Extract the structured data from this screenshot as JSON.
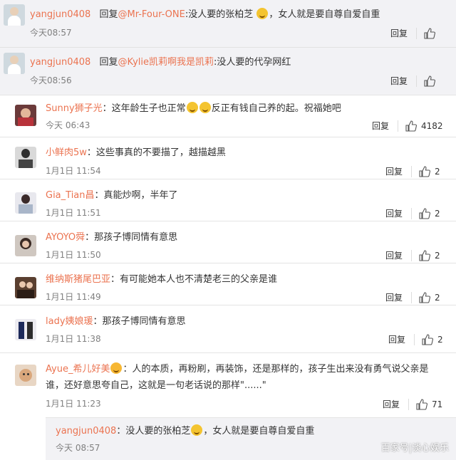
{
  "comments": [
    {
      "username": "yangjun0408",
      "reply_prefix": "回复",
      "reply_target": "@Mr-Four-ONE",
      "text_before": ":没人要的张柏芝",
      "text_after": "，女人就是要自尊自爱自重",
      "time": "今天08:57",
      "reply_label": "回复",
      "likes": ""
    },
    {
      "username": "yangjun0408",
      "reply_prefix": "回复",
      "reply_target": "@Kylie凯莉啊我是凯莉",
      "text_before": ":没人要的代孕网红",
      "time": "今天08:56",
      "reply_label": "回复",
      "likes": ""
    },
    {
      "username": "Sunny狮子光",
      "text_before": "：这年龄生子也正常",
      "text_after": "反正有钱自己养的起。祝福她吧",
      "time": "今天 06:43",
      "reply_label": "回复",
      "likes": "4182"
    },
    {
      "username": "小鲜肉5w",
      "text_before": "：这些事真的不要描了，越描越黑",
      "time": "1月1日 11:54",
      "reply_label": "回复",
      "likes": "2"
    },
    {
      "username": "Gia_Tian昌",
      "text_before": "：真能炒啊，半年了",
      "time": "1月1日 11:51",
      "reply_label": "回复",
      "likes": "2"
    },
    {
      "username": "AYOYO舜",
      "text_before": "：那孩子博同情有意思",
      "time": "1月1日 11:50",
      "reply_label": "回复",
      "likes": "2"
    },
    {
      "username": "维纳斯猪尾巴亚",
      "text_before": "：有可能她本人也不清楚老三的父亲是谁",
      "time": "1月1日 11:49",
      "reply_label": "回复",
      "likes": "2"
    },
    {
      "username": "lady姨娘瑗",
      "text_before": "：那孩子博同情有意思",
      "time": "1月1日 11:38",
      "reply_label": "回复",
      "likes": "2"
    },
    {
      "username": "Ayue_希儿好美",
      "text_before": "：人的本质，再粉刷，再装饰，还是那样的，孩子生出来没有勇气说父亲是",
      "text_line2": "谁，还好意思夸自己，这就是一句老话说的那样\"......\"",
      "time": "1月1日 11:23",
      "reply_label": "回复",
      "likes": "71"
    }
  ],
  "nested_reply": {
    "username": "yangjun0408",
    "text_before": "：没人要的张柏芝",
    "text_after": "，女人就是要自尊自爱自重",
    "time": "今天 08:57"
  },
  "watermark": "百家号|谈心娱乐",
  "icons": {
    "thumb": "thumbs-up-icon",
    "emoji": "laughing-tears-emoji"
  },
  "colors": {
    "username": "#eb7350",
    "time": "#808080",
    "highlight_bg": "#f2f2f5"
  }
}
